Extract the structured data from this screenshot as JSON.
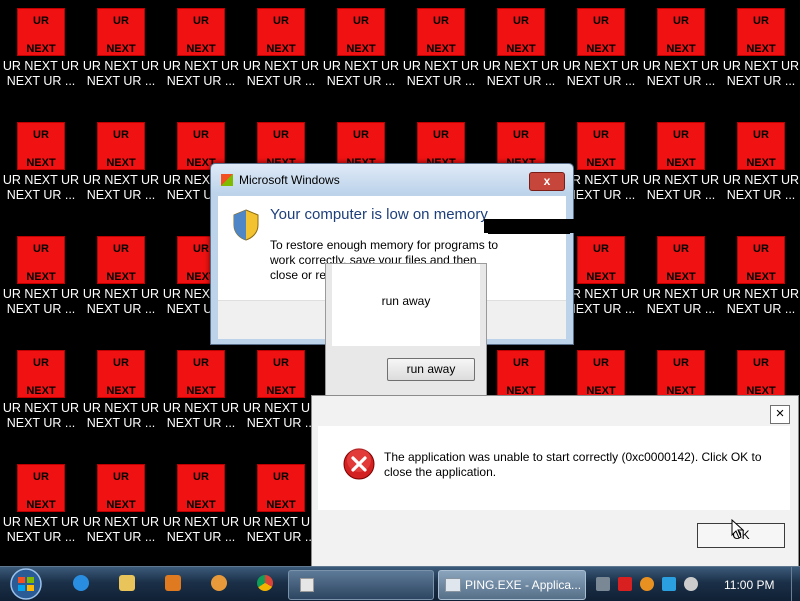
{
  "desktop": {
    "icon_top": "UR",
    "icon_bottom": "NEXT",
    "icon_label": "UR NEXT UR\nNEXT UR ..."
  },
  "mem_window": {
    "title": "Microsoft Windows",
    "close": "x",
    "heading": "Your computer is low on memory",
    "text": "To restore enough memory for programs to work correctly, save your files and then close or restart all open programs."
  },
  "run_dialog": {
    "text": "run away",
    "button": "run away"
  },
  "error_dialog": {
    "close": "×",
    "message": "The application was unable to start correctly (0xc0000142). Click OK to close the application.",
    "ok": "OK"
  },
  "taskbar": {
    "active_task": "PING.EXE - Applica...",
    "clock": "11:00 PM"
  },
  "colors": {
    "icon_red": "#f01212",
    "taskbar": "#1b3048",
    "heading_blue": "#1e3f7a"
  }
}
